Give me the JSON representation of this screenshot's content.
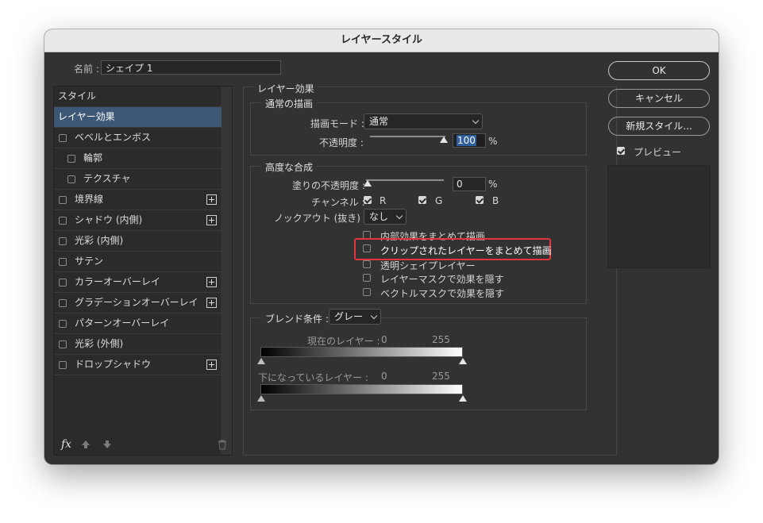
{
  "window": {
    "title": "レイヤースタイル"
  },
  "name_field": {
    "label": "名前 :",
    "value": "シェイプ 1"
  },
  "styles_list": {
    "header": "スタイル",
    "items": [
      {
        "label": "レイヤー効果",
        "checkbox": false,
        "plus": false,
        "selected": true
      },
      {
        "label": "ベベルとエンボス",
        "checkbox": true,
        "plus": false
      },
      {
        "label": "輪郭",
        "checkbox": true,
        "plus": false,
        "indent": true
      },
      {
        "label": "テクスチャ",
        "checkbox": true,
        "plus": false,
        "indent": true
      },
      {
        "label": "境界線",
        "checkbox": true,
        "plus": true
      },
      {
        "label": "シャドウ (内側)",
        "checkbox": true,
        "plus": true
      },
      {
        "label": "光彩 (内側)",
        "checkbox": true,
        "plus": false
      },
      {
        "label": "サテン",
        "checkbox": true,
        "plus": false
      },
      {
        "label": "カラーオーバーレイ",
        "checkbox": true,
        "plus": true
      },
      {
        "label": "グラデーションオーバーレイ",
        "checkbox": true,
        "plus": true
      },
      {
        "label": "パターンオーバーレイ",
        "checkbox": true,
        "plus": false
      },
      {
        "label": "光彩 (外側)",
        "checkbox": true,
        "plus": false
      },
      {
        "label": "ドロップシャドウ",
        "checkbox": true,
        "plus": true
      }
    ],
    "footer": {
      "fx": "fx"
    }
  },
  "layer_effects": {
    "title": "レイヤー効果",
    "normal_blending": {
      "title": "通常の描画",
      "blend_mode_label": "描画モード :",
      "blend_mode_value": "通常",
      "opacity_label": "不透明度 :",
      "opacity_value": "100",
      "opacity_fraction": 1.0,
      "opacity_unit": "%"
    },
    "advanced_blending": {
      "title": "高度な合成",
      "fill_opacity_label": "塗りの不透明度 :",
      "fill_opacity_value": "0",
      "fill_opacity_fraction": 0.0,
      "fill_opacity_unit": "%",
      "channels_label": "チャンネル :",
      "channels": [
        {
          "label": "R",
          "checked": true
        },
        {
          "label": "G",
          "checked": true
        },
        {
          "label": "B",
          "checked": true
        }
      ],
      "knockout_label": "ノックアウト (抜き) :",
      "knockout_value": "なし",
      "options": [
        {
          "label": "内部効果をまとめて描画",
          "checked": false
        },
        {
          "label": "クリップされたレイヤーをまとめて描画",
          "checked": false,
          "highlighted": true
        },
        {
          "label": "透明シェイプレイヤー",
          "checked": false
        },
        {
          "label": "レイヤーマスクで効果を隠す",
          "checked": false
        },
        {
          "label": "ベクトルマスクで効果を隠す",
          "checked": false
        }
      ]
    },
    "blend_if": {
      "title": "ブレンド条件 :",
      "value": "グレー",
      "this_layer_label": "現在のレイヤー :",
      "this_layer_min": "0",
      "this_layer_max": "255",
      "underlying_label": "下になっているレイヤー :",
      "underlying_min": "0",
      "underlying_max": "255"
    }
  },
  "buttons": {
    "ok": "OK",
    "cancel": "キャンセル",
    "new_style": "新規スタイル...",
    "preview_label": "プレビュー",
    "preview_checked": true
  },
  "colors": {
    "highlight": "#e0353c",
    "selection": "#3d5876",
    "dialog_bg": "#323232"
  }
}
